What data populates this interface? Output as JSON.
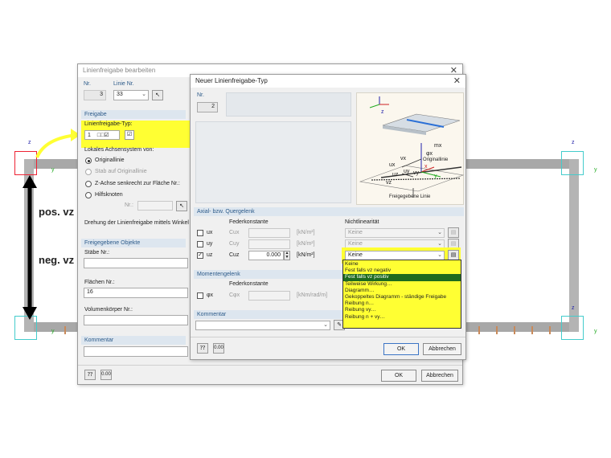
{
  "background": {
    "annotation_pos": "pos. vz",
    "annotation_neg": "neg. vz",
    "axis_z": "z",
    "axis_y": "y"
  },
  "main_dialog": {
    "title": "Linienfreigabe bearbeiten",
    "nr_label": "Nr.",
    "nr_value": "3",
    "linie_label": "Linie Nr.",
    "linie_value": "33",
    "section_freigabe": "Freigabe",
    "typ_label": "Linienfreigabe-Typ:",
    "typ_value": "1",
    "achsen_label": "Lokales Achsensystem von:",
    "radio_options": [
      "Originallinie",
      "Stab auf Originallinie",
      "Z-Achse senkrecht zur Fläche Nr.:",
      "Hilfsknoten"
    ],
    "hilfsknoten_nr_label": "Nr.:",
    "drehung_label": "Drehung der Linienfreigabe mittels Winkel",
    "section_objekte": "Freigegebene Objekte",
    "staebe_label": "Stäbe Nr.:",
    "flaechen_label": "Flächen Nr.:",
    "flaechen_value": "16",
    "volumen_label": "Volumenkörper Nr.:",
    "section_kommentar": "Kommentar",
    "ok_label": "OK",
    "cancel_label": "Abbrechen"
  },
  "type_dialog": {
    "title": "Neuer Linienfreigabe-Typ",
    "nr_label": "Nr.",
    "nr_value": "2",
    "diagram_labels": {
      "originallinie": "Originallinie",
      "freigegebene": "Freigegebene Linie",
      "mx": "mx",
      "phix": "φx",
      "ux": "ux",
      "vx": "vx",
      "uy": "uy",
      "vy": "vy",
      "uz": "uz",
      "vz": "vz",
      "x": "x",
      "y": "y",
      "z": "z"
    },
    "section_axial": "Axial- bzw. Quergelenk",
    "federkonstante": "Federkonstante",
    "nichtlinearitaet": "Nichtlinearität",
    "rows": [
      {
        "label": "ux",
        "c_label": "Cux",
        "value": "",
        "unit": "[kN/m²]",
        "nonlin": "Keine",
        "checked": false
      },
      {
        "label": "uy",
        "c_label": "Cuy",
        "value": "",
        "unit": "[kN/m²]",
        "nonlin": "Keine",
        "checked": false
      },
      {
        "label": "uz",
        "c_label": "Cuz",
        "value": "0.000",
        "unit": "[kN/m²]",
        "nonlin": "Keine",
        "checked": true
      }
    ],
    "section_moment": "Momentengelenk",
    "moment_row": {
      "label": "φx",
      "c_label": "Cφx",
      "unit": "[kNm/rad/m]"
    },
    "section_kommentar": "Kommentar",
    "dropdown_options": [
      "Keine",
      "Fest falls vz negativ",
      "Fest falls vz positiv",
      "Teilweise Wirkung…",
      "Diagramm…",
      "Gekoppeltes Diagramm - ständige Freigabe",
      "Reibung n…",
      "Reibung vy…",
      "Reibung n + vy…"
    ],
    "dropdown_selected": "Fest falls vz positiv",
    "ok_label": "OK",
    "cancel_label": "Abbrechen"
  },
  "colors": {
    "highlight": "#ffff33",
    "section_text": "#2d5b8a",
    "selected": "#1e6b1e"
  }
}
